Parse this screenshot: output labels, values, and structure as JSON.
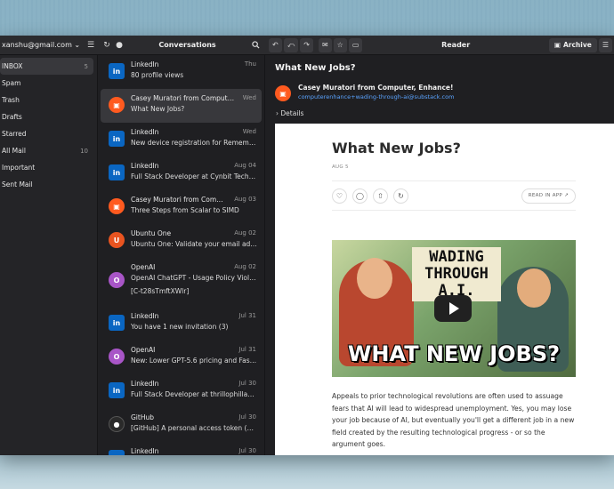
{
  "account": "xanshu@gmail.com",
  "folders": [
    {
      "name": "INBOX",
      "count": "5"
    },
    {
      "name": "Spam",
      "count": ""
    },
    {
      "name": "Trash",
      "count": ""
    },
    {
      "name": "Drafts",
      "count": ""
    },
    {
      "name": "Starred",
      "count": ""
    },
    {
      "name": "All Mail",
      "count": "10"
    },
    {
      "name": "Important",
      "count": ""
    },
    {
      "name": "Sent Mail",
      "count": ""
    }
  ],
  "list_title": "Conversations",
  "messages": [
    {
      "sender": "LinkedIn",
      "date": "Thu",
      "subject": "80 profile views",
      "avatar": "in"
    },
    {
      "sender": "Casey Muratori from Computer, ...",
      "date": "Wed",
      "subject": "What New Jobs?",
      "avatar": "cm"
    },
    {
      "sender": "LinkedIn",
      "date": "Wed",
      "subject": "New device registration for Remembe...",
      "avatar": "in"
    },
    {
      "sender": "LinkedIn",
      "date": "Aug 04",
      "subject": "Full Stack Developer at Cynbit Techn...",
      "avatar": "in"
    },
    {
      "sender": "Casey Muratori from Comput...",
      "date": "Aug 03",
      "subject": "Three Steps from Scalar to SIMD",
      "avatar": "cm"
    },
    {
      "sender": "Ubuntu One",
      "date": "Aug 02",
      "subject": "Ubuntu One: Validate your email addr...",
      "avatar": "U"
    },
    {
      "sender": "OpenAI",
      "date": "Aug 02",
      "subject": "OpenAI ChatGPT - Usage Policy Viola...",
      "subject2": "[C-t28sTmftXWlr]",
      "avatar": "O"
    },
    {
      "sender": "LinkedIn",
      "date": "Jul 31",
      "subject": "You have 1 new invitation (3)",
      "avatar": "in"
    },
    {
      "sender": "OpenAI",
      "date": "Jul 31",
      "subject": "New: Lower GPT-5.6 pricing and Fast ...",
      "avatar": "O"
    },
    {
      "sender": "LinkedIn",
      "date": "Jul 30",
      "subject": "Full Stack Developer at thrillophillaa (...",
      "avatar": "in"
    },
    {
      "sender": "GitHub",
      "date": "Jul 30",
      "subject": "[GitHub] A personal access token (cla...",
      "avatar": "gh"
    },
    {
      "sender": "LinkedIn",
      "date": "Jul 30",
      "subject": "",
      "avatar": "in"
    }
  ],
  "reader": {
    "title": "Reader",
    "archive_label": "Archive",
    "subject": "What New Jobs?",
    "from_name": "Casey Muratori from Computer, Enhance!",
    "from_address": "computerenhance+wading-through-ai@substack.com",
    "details_label": "Details",
    "article_title": "What New Jobs?",
    "article_date": "AUG 5",
    "read_in_app": "READ IN APP",
    "thumb_top": "WADING THROUGH A.I.",
    "thumb_bottom": "WHAT NEW JOBS?",
    "body": "Appeals to prior technological revolutions are often used to assuage fears that AI will lead to widespread unemployment. Yes, you may lose your job because of AI, but eventually you'll get a different job in a new field created by the resulting technological progress - or so the argument goes."
  }
}
